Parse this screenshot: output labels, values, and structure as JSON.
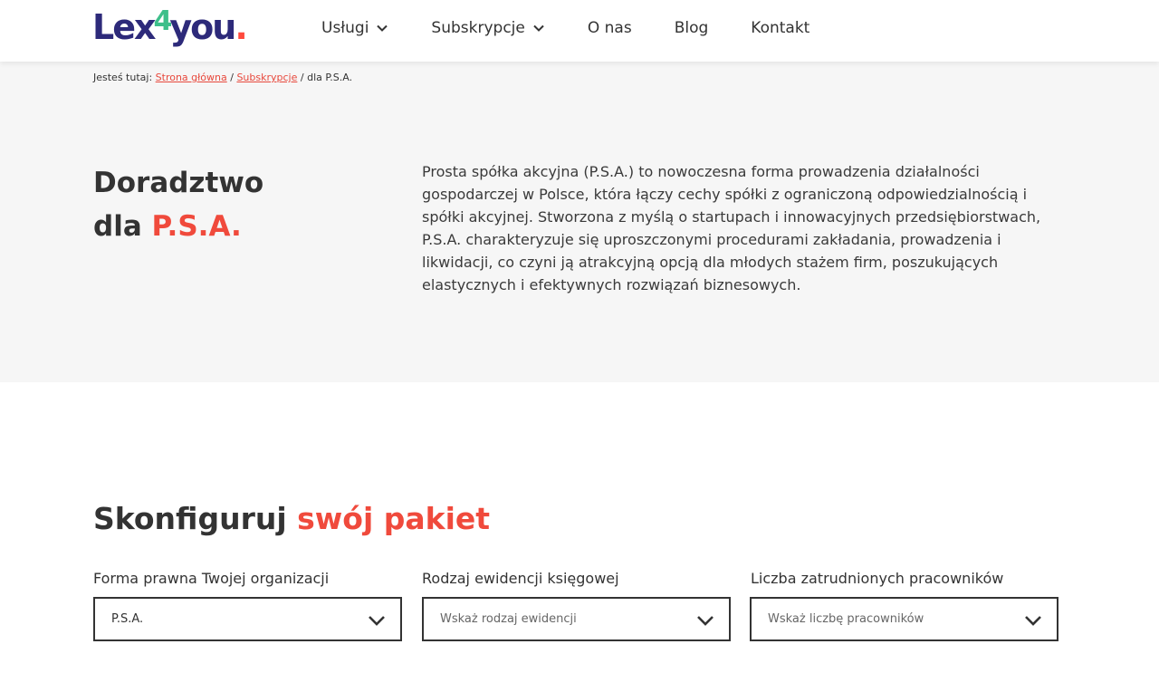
{
  "logo": {
    "part1": "Lex",
    "part2": "4",
    "part3": "you",
    "dot": "."
  },
  "nav": {
    "items": [
      {
        "label": "Usługi",
        "has_dropdown": true
      },
      {
        "label": "Subskrypcje",
        "has_dropdown": true
      },
      {
        "label": "O nas",
        "has_dropdown": false
      },
      {
        "label": "Blog",
        "has_dropdown": false
      },
      {
        "label": "Kontakt",
        "has_dropdown": false
      }
    ]
  },
  "breadcrumb": {
    "prefix": "Jesteś tutaj:",
    "home": "Strona główna",
    "sep1": "/",
    "parent": "Subskrypcje",
    "sep2": "/",
    "current": "dla P.S.A."
  },
  "hero": {
    "title_line1": "Doradztwo",
    "title_line2_prefix": "dla ",
    "title_line2_accent": "P.S.A.",
    "description": "Prosta spółka akcyjna (P.S.A.) to nowoczesna forma prowadzenia działalności gospodarczej w Polsce, która łączy cechy spółki z ograniczoną odpowiedzialnością i spółki akcyjnej. Stworzona z myślą o startupach i innowacyjnych przedsiębiorstwach, P.S.A. charakteryzuje się uproszczonymi procedurami zakładania, prowadzenia i likwidacji, co czyni ją atrakcyjną opcją dla młodych stażem firm, poszukujących elastycznych i efektywnych rozwiązań biznesowych."
  },
  "config": {
    "title_prefix": "Skonfiguruj ",
    "title_accent": "swój pakiet",
    "fields": [
      {
        "label": "Forma prawna Twojej organizacji",
        "value": "P.S.A.",
        "placeholder": ""
      },
      {
        "label": "Rodzaj ewidencji księgowej",
        "value": "",
        "placeholder": "Wskaż rodzaj ewidencji"
      },
      {
        "label": "Liczba zatrudnionych pracowników",
        "value": "",
        "placeholder": "Wskaż liczbę pracowników"
      }
    ]
  },
  "colors": {
    "brand_navy": "#2d2a7a",
    "brand_green": "#3dbf8a",
    "accent_red": "#f04a3c",
    "hero_bg": "#f6f6f6"
  }
}
